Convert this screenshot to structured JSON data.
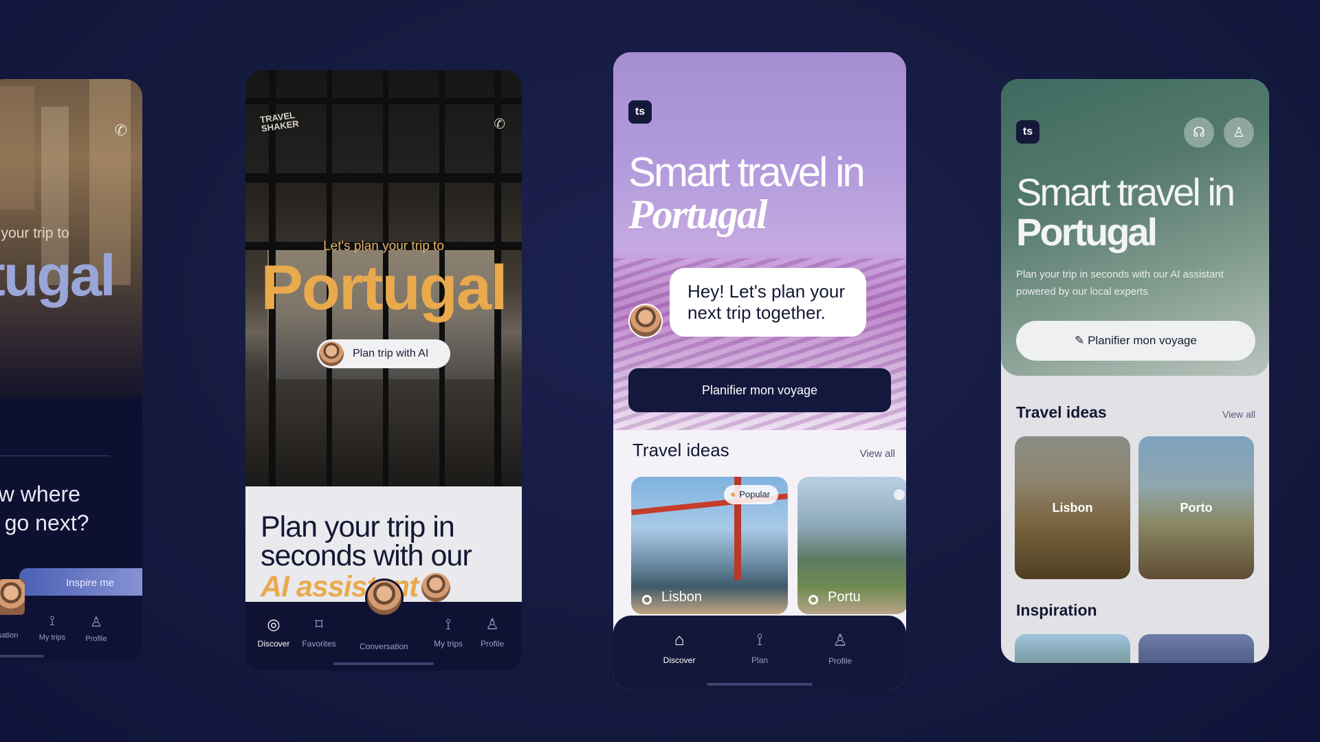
{
  "screen1": {
    "pre_title": "n your trip to",
    "title": "tugal",
    "question": "ow where\no go next?",
    "inspire_label": "Inspire me",
    "nav": [
      {
        "label": "versation",
        "icon": "avatar"
      },
      {
        "label": "My trips",
        "icon": "route-icon"
      },
      {
        "label": "Profile",
        "icon": "user-icon"
      }
    ]
  },
  "screen2": {
    "logo": "TRAVEL\nSHAKER",
    "pre_title": "Let's plan your trip to",
    "title": "Portugal",
    "plan_button": "Plan trip with AI",
    "headline": "Plan your trip in\nseconds with our",
    "headline_accent": "AI assistant",
    "nav": [
      {
        "label": "Discover",
        "icon": "compass-icon",
        "active": true
      },
      {
        "label": "Favorites",
        "icon": "bookmark-icon",
        "active": false
      },
      {
        "label": "Conversation",
        "icon": "avatar",
        "active": false
      },
      {
        "label": "My trips",
        "icon": "route-icon",
        "active": false
      },
      {
        "label": "Profile",
        "icon": "user-icon",
        "active": false
      }
    ]
  },
  "screen3": {
    "logo": "ts",
    "title_line1": "Smart travel in",
    "title_line2": "Portugal",
    "chat_message": "Hey! Let's plan your next trip together.",
    "cta": "Planifier mon voyage",
    "section_title": "Travel ideas",
    "view_all": "View all",
    "cards": [
      {
        "name": "Lisbon",
        "badge": "Popular"
      },
      {
        "name": "Portu",
        "badge": ""
      }
    ],
    "nav": [
      {
        "label": "Discover",
        "icon": "home-icon",
        "active": true
      },
      {
        "label": "Plan",
        "icon": "route-icon",
        "active": false
      },
      {
        "label": "Profile",
        "icon": "user-icon",
        "active": false
      }
    ]
  },
  "screen4": {
    "logo": "ts",
    "title_line1": "Smart travel in",
    "title_line2": "Portugal",
    "subtitle": "Plan your trip in seconds with our AI assistant powered by our local experts",
    "cta": "Planifier mon voyage",
    "section_title": "Travel ideas",
    "view_all": "View all",
    "cards": [
      {
        "name": "Lisbon"
      },
      {
        "name": "Porto"
      }
    ],
    "section2_title": "Inspiration"
  },
  "colors": {
    "background": "#151a3f",
    "accent_gold": "#e9a94d",
    "navy": "#14183c",
    "lavender": "#b29bdc",
    "sage": "#54796c"
  }
}
